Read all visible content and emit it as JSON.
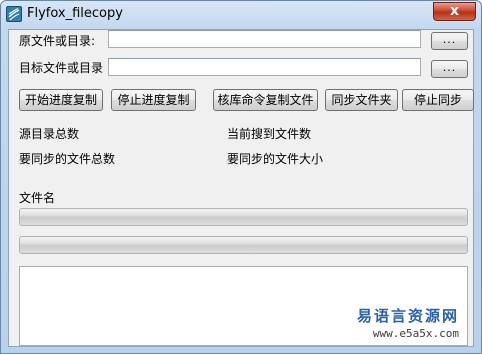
{
  "window": {
    "title": "Flyfox_filecopy",
    "close_glyph": "x",
    "icon": "app-logo-icon"
  },
  "source": {
    "label": "原文件或目录:",
    "value": "",
    "browse_label": "..."
  },
  "target": {
    "label": "目标文件或目录",
    "value": "",
    "browse_label": "..."
  },
  "toolbar": {
    "start_label": "开始进度复制",
    "stop_label": "停止进度复制",
    "check_label": "核库命令复制文件",
    "sync_folder_label": "同步文件夹",
    "stop_sync_label": "停止同步"
  },
  "stats": {
    "source_total_label": "源目录总数",
    "current_found_label": "当前搜到文件数",
    "sync_total_label": "要同步的文件总数",
    "sync_size_label": "要同步的文件大小"
  },
  "file": {
    "name_label": "文件名"
  },
  "progress": {
    "file_progress": 0,
    "total_progress": 0
  },
  "log": {
    "text": ""
  },
  "watermark": {
    "name": "易语言资源网",
    "url": "www.e5a5x.com"
  },
  "colors": {
    "title_bar": "#c3d8ef",
    "close_button": "#c6492f",
    "progress_fill": "#37c847",
    "watermark": "#2b5fb0"
  }
}
